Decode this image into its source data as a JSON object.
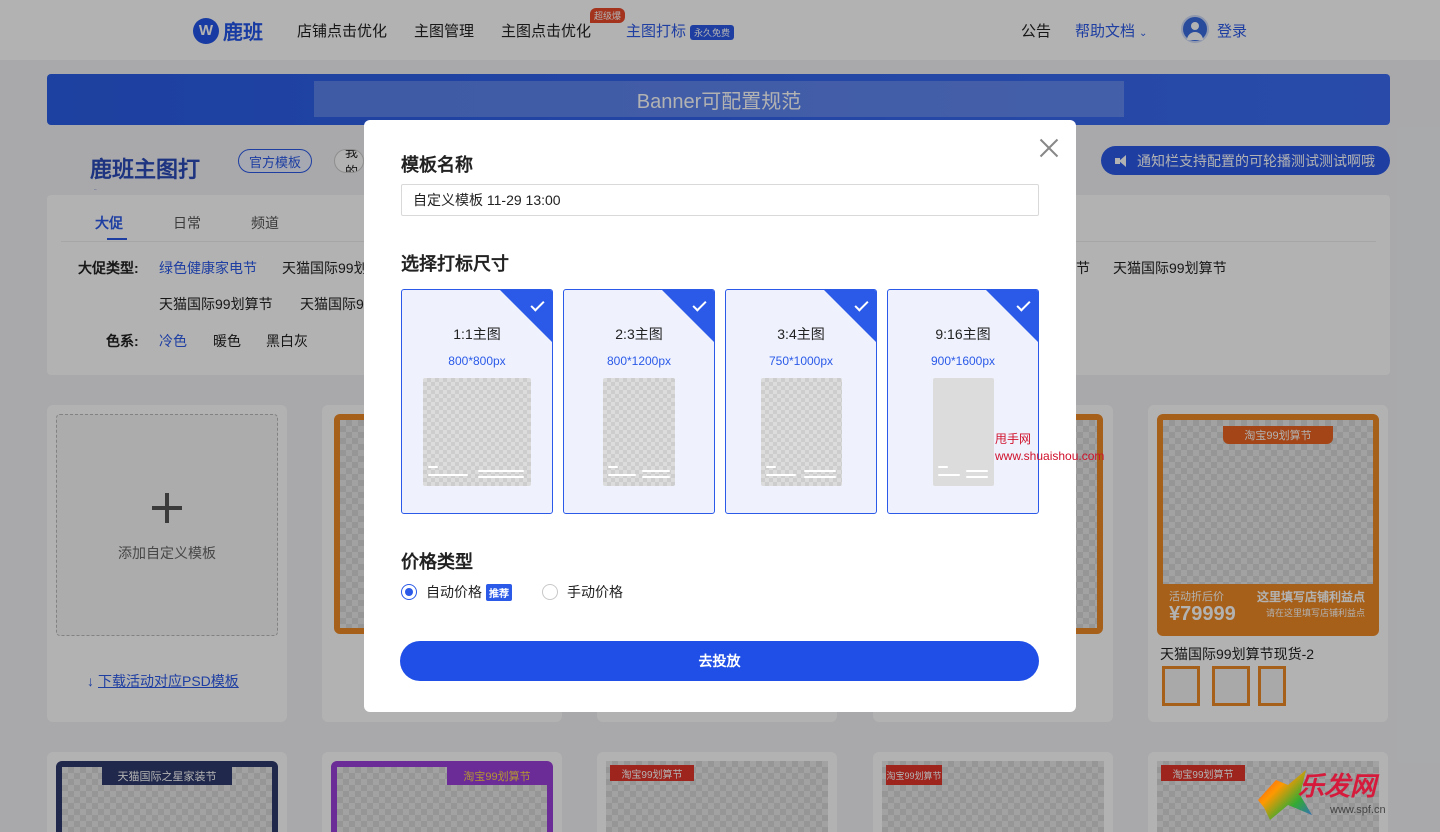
{
  "nav": {
    "logo_mark": "W",
    "logo_text": "鹿班",
    "items": [
      "店铺点击优化",
      "主图管理",
      "主图点击优化",
      "主图打标"
    ],
    "hot_badge": "超级爆",
    "free_badge": "永久免费",
    "announcement": "公告",
    "help": "帮助文档",
    "login": "登录"
  },
  "banner": {
    "text": "Banner可配置规范"
  },
  "header": {
    "title": "鹿班主图打标",
    "official_pill": "官方模板",
    "mine_pill": "我的",
    "notice": "通知栏支持配置的可轮播测试测试啊哦"
  },
  "filters": {
    "tabs": [
      "大促",
      "日常",
      "频道"
    ],
    "promo_label": "大促类型:",
    "promo_options": [
      "绿色健康家电节",
      "天猫国际99划",
      "节",
      "天猫国际99划算节",
      "天猫国际99划算节",
      "天猫国际9"
    ],
    "color_label": "色系:",
    "color_options": [
      "冷色",
      "暖色",
      "黑白灰"
    ]
  },
  "cards": {
    "add_label": "添加自定义模板",
    "download_link": "下载活动对应PSD模板",
    "template_head": "淘宝99划算节",
    "template_price_label": "活动折后价",
    "template_price": "¥79999",
    "template_desc": "这里填写店铺利益点",
    "template_desc2": "请在这里填写店铺利益点",
    "template_name": "天猫国际99划算节现货-2",
    "bottom_head_1": "天猫国际之星家装节",
    "bottom_head_2": "淘宝99划算节",
    "bottom_head_3": "淘宝99划算节",
    "bottom_head_4": "淘宝99划算节",
    "bottom_head_5": "淘宝99划算节"
  },
  "modal": {
    "name_title": "模板名称",
    "name_value": "自定义模板 11-29 13:00",
    "size_title": "选择打标尺寸",
    "sizes": [
      {
        "label": "1:1主图",
        "dims": "800*800px"
      },
      {
        "label": "2:3主图",
        "dims": "800*1200px"
      },
      {
        "label": "3:4主图",
        "dims": "750*1000px"
      },
      {
        "label": "9:16主图",
        "dims": "900*1600px"
      }
    ],
    "price_title": "价格类型",
    "price_auto": "自动价格",
    "price_auto_badge": "推荐",
    "price_manual": "手动价格",
    "submit": "去投放"
  },
  "watermarks": {
    "site_cn": "甩手网",
    "site_url": "www.shuaishou.com",
    "logo_cn": "乐发网",
    "logo_url": "www.spf.cn"
  }
}
